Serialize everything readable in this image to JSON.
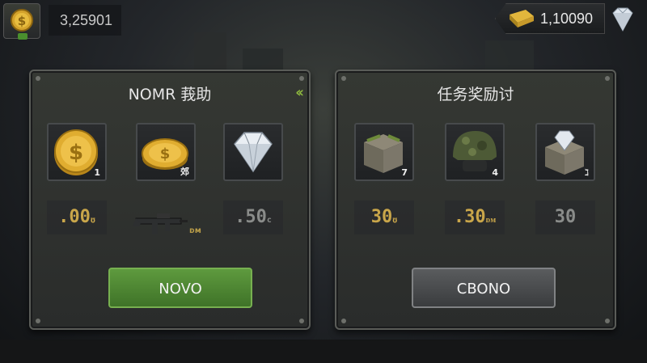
{
  "top_bar": {
    "coin_amount": "3,25901",
    "gold_amount": "1,10090"
  },
  "left_panel": {
    "title": "NOMR 莪助",
    "items": [
      {
        "icon": "gold-coin-icon",
        "qty": "1"
      },
      {
        "icon": "gold-coin-icon",
        "qty": "郊"
      },
      {
        "icon": "diamond-icon",
        "qty": ""
      }
    ],
    "prices": [
      {
        "value": ".00",
        "suffix": "ʊ"
      },
      {
        "value": "",
        "suffix": "ᴅᴍ"
      },
      {
        "value": ".50",
        "suffix": "c"
      }
    ],
    "button_label": "NOVO"
  },
  "right_panel": {
    "title": "任务奖励讨",
    "items": [
      {
        "icon": "supply-crate-icon",
        "qty": "7"
      },
      {
        "icon": "camo-helmet-icon",
        "qty": "4"
      },
      {
        "icon": "diamond-crate-icon",
        "qty": "ℷ"
      }
    ],
    "prices": [
      {
        "value": "30",
        "suffix": "ʊ"
      },
      {
        "value": ".30",
        "suffix": "ᴅᴍ"
      },
      {
        "value": "30",
        "suffix": ""
      }
    ],
    "button_label": "CBONO"
  },
  "colors": {
    "accent_green": "#5e9a3e",
    "gold": "#c9a64a",
    "panel_bg": "#2f322f"
  }
}
